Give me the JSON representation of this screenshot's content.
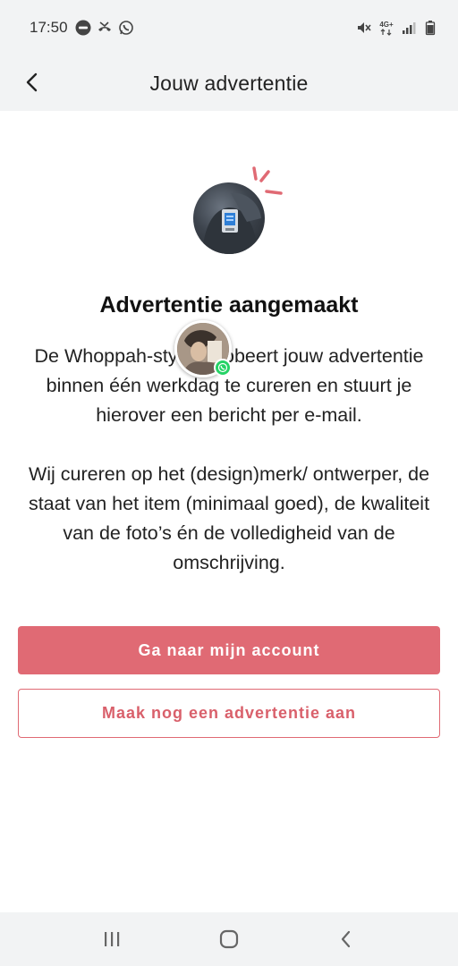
{
  "status_bar": {
    "time": "17:50",
    "left_icons": [
      "buienradar-icon",
      "missed-call-icon",
      "whatsapp-icon"
    ],
    "right_icons": [
      "mute-icon",
      "4g-data-icon",
      "signal-icon",
      "battery-icon"
    ],
    "network_label": "4G+"
  },
  "header": {
    "title": "Jouw advertentie",
    "back_icon": "chevron-left-icon"
  },
  "main": {
    "title": "Advertentie aangemaakt",
    "paragraph1": "De Whoppah-stylist probeert jouw advertentie binnen één werkdag te cureren en stuurt je hierover een bericht per e-mail.",
    "paragraph2": "Wij cureren op het (design)merk/ ontwerper, de staat van het item (minimaal goed), de kwaliteit van de foto’s én de volledigheid van de omschrijving.",
    "primary_button": "Ga naar mijn account",
    "secondary_button": "Maak nog een advertentie aan"
  },
  "colors": {
    "accent": "#e06a74",
    "bar_background": "#f2f3f4",
    "whatsapp_green": "#25d366"
  },
  "nav_bar": {
    "icons": [
      "recents-icon",
      "home-icon",
      "back-icon"
    ]
  }
}
